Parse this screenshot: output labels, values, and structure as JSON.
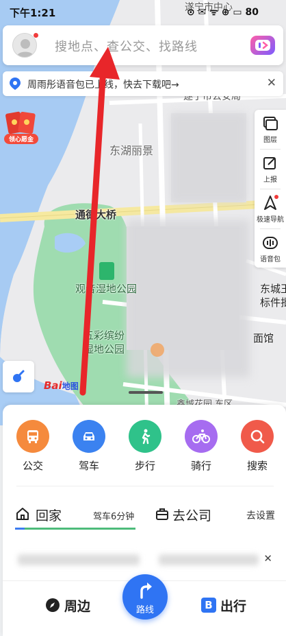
{
  "status_bar": {
    "time": "下午1:21",
    "right_indicators": "⊙ ✉ ᯤ ⊕ ▭ 80"
  },
  "search": {
    "placeholder": "搜地点、查公交、找路线",
    "avatar_icon": "user-avatar-icon",
    "voice_icon": "voice-assistant-icon"
  },
  "notice": {
    "text": "周雨彤语音包已上线，快去下载吧→",
    "close": "✕"
  },
  "redpacket": {
    "label": "领心愿金"
  },
  "tools": [
    {
      "label": "图层",
      "icon": "layers-icon"
    },
    {
      "label": "上报",
      "icon": "report-icon"
    },
    {
      "label": "极速导航",
      "icon": "navigation-arrow-icon"
    },
    {
      "label": "语音包",
      "icon": "voice-pack-icon"
    }
  ],
  "map": {
    "labels": {
      "road_top": "遂宁市中心",
      "gov": "遂宁市公安局",
      "donghu": "东湖丽景",
      "bridge": "通德大桥",
      "wetland": "观音湿地公园",
      "wucai_1": "五彩缤纷",
      "wucai_2": "湿地公园",
      "dongcheng_1": "东城王",
      "dongcheng_2": "标件批",
      "museum": "面馆",
      "bottom": "鑫城花园 东区"
    },
    "logo_text": "Bai",
    "logo_du": "地图"
  },
  "modes": [
    {
      "label": "公交",
      "icon": "bus-icon",
      "color": "#f58a3d"
    },
    {
      "label": "驾车",
      "icon": "car-icon",
      "color": "#3b82f0"
    },
    {
      "label": "步行",
      "icon": "walk-icon",
      "color": "#2fc28a"
    },
    {
      "label": "骑行",
      "icon": "bike-icon",
      "color": "#a66cf0"
    },
    {
      "label": "搜索",
      "icon": "search-icon",
      "color": "#f05a4a"
    }
  ],
  "shortcuts": {
    "home": "回家",
    "home_eta": "驾车6分钟",
    "work": "去公司",
    "setting": "去设置"
  },
  "bottom_nav": {
    "around": "周边",
    "route": "路线",
    "travel": "出行"
  },
  "colors": {
    "accent": "#2f74f3",
    "water": "#a9cdf5",
    "park": "#9fdcb0",
    "road": "#f6e9a0",
    "annotation": "#e8262a"
  }
}
